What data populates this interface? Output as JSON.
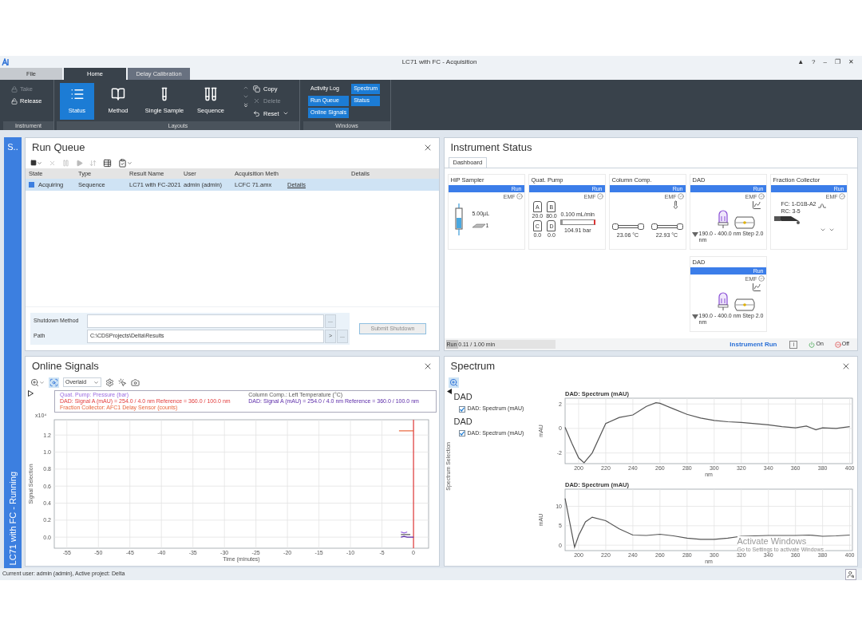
{
  "window": {
    "title": "LC71 with FC - Acquisition",
    "controls": [
      "▲",
      "?",
      "–",
      "❐",
      "✕"
    ]
  },
  "file_menu": "File",
  "ribbon_tabs": [
    {
      "label": "Home",
      "selected": true
    },
    {
      "label": "Delay Calibration",
      "selected": false
    }
  ],
  "ribbon": {
    "instrument": {
      "label": "Instrument",
      "items": [
        {
          "kind": "take",
          "label": "Take",
          "disabled": true
        },
        {
          "kind": "release",
          "label": "Release",
          "disabled": false
        }
      ]
    },
    "layouts": {
      "label": "Layouts",
      "views": [
        {
          "kind": "status",
          "label": "Status",
          "selected": true
        },
        {
          "kind": "method",
          "label": "Method",
          "selected": false
        },
        {
          "kind": "single_sample",
          "label": "Single Sample",
          "selected": false
        },
        {
          "kind": "sequence",
          "label": "Sequence",
          "selected": false
        }
      ],
      "edit_items": [
        {
          "kind": "copy",
          "label": "Copy",
          "disabled": false
        },
        {
          "kind": "delete",
          "label": "Delete",
          "disabled": true
        },
        {
          "kind": "reset",
          "label": "Reset",
          "disabled": false
        }
      ]
    },
    "windows": {
      "label": "Windows",
      "items": [
        {
          "label": "Activity Log",
          "selected": false
        },
        {
          "label": "Spectrum",
          "selected": true
        },
        {
          "label": "Run Queue",
          "selected": true
        },
        {
          "label": "Status",
          "selected": true
        },
        {
          "label": "Online Signals",
          "selected": true
        }
      ]
    }
  },
  "sidebar": {
    "title": "S..",
    "state": "LC71 with FC - Running"
  },
  "run_queue": {
    "title": "Run Queue",
    "columns": [
      "State",
      "Type",
      "Result Name",
      "User",
      "Acquisition Meth",
      "",
      "Details"
    ],
    "rows": [
      {
        "selected": true,
        "cells": [
          {
            "kind": "state",
            "text": "Acquiring"
          },
          {
            "kind": "text",
            "text": "Sequence"
          },
          {
            "kind": "text",
            "text": "LC71 with FC-2021"
          },
          {
            "kind": "text",
            "text": "admin (admin)"
          },
          {
            "kind": "text",
            "text": "LCFC 71.amx"
          },
          {
            "kind": "link",
            "text": "Details"
          }
        ]
      }
    ],
    "shutdown": {
      "method_label": "Shutdown Method",
      "method_browse": "...",
      "path_label": "Path",
      "path_value": "C:\\CDSProjects\\Delta\\Results",
      "path_next": ">",
      "path_browse": "...",
      "submit": "Submit Shutdown",
      "submit_disabled": true
    }
  },
  "instrument_status": {
    "title": "Instrument Status",
    "tabs": [
      {
        "label": "Dashboard",
        "selected": true
      }
    ],
    "modules": [
      {
        "kind": "sampler",
        "name": "HiP Sampler",
        "status": "Run",
        "emf": "EMF",
        "volume": "5.00µL",
        "vial": "1"
      },
      {
        "kind": "pump",
        "name": "Quat. Pump",
        "status": "Run",
        "emf": "EMF",
        "solvents": [
          {
            "letter": "A",
            "value": "20.0"
          },
          {
            "letter": "B",
            "value": "80.0"
          },
          {
            "letter": "C",
            "value": "0.0"
          },
          {
            "letter": "D",
            "value": "0.0"
          }
        ],
        "flow": "0.100 mL/min",
        "pressure": "104.91 bar",
        "level": 0.06
      },
      {
        "kind": "column",
        "name": "Column Comp.",
        "status": "Run",
        "emf": "EMF",
        "temperatures": [
          "23.06 °C",
          "22.93 °C"
        ]
      },
      {
        "kind": "dad",
        "name": "DAD",
        "status": "Run",
        "emf": "EMF",
        "range": "190.0 - 400.0 nm Step 2.0 nm"
      },
      {
        "kind": "fraction",
        "name": "Fraction Collector",
        "status": "Run",
        "emf": "EMF",
        "positions": [
          "FC: 1-D1B-A2",
          "RC: 3-5"
        ]
      },
      {
        "kind": "dad",
        "name": "DAD",
        "status": "Run",
        "emf": "EMF",
        "range": "190.0 - 400.0 nm Step 2.0 nm"
      }
    ],
    "footer": {
      "progress_text": "Run 0.11 / 1.00 min",
      "level": 0.11,
      "instrument_run": "Instrument Run",
      "info": "i",
      "on": "On",
      "off": "Off"
    }
  },
  "online_signals": {
    "title": "Online Signals",
    "view_mode": "Overlaid",
    "y_scale": "x10⁴",
    "chart_data": {
      "type": "line",
      "grid": true,
      "xlabel": "Time (minutes)",
      "ylabel": "Signal Selection",
      "x": [
        -2.3,
        -2,
        -1.5,
        -1,
        -0.5,
        0,
        0
      ],
      "series": [
        {
          "name": "Quat. Pump: Pressure (bar)",
          "color": "#9a6ae0",
          "values": [
            null,
            0.06,
            0.05,
            0.06,
            null,
            null,
            null
          ]
        },
        {
          "name": "DAD: Signal A (mAU) = 254.0 / 4.0 nm Reference = 360.0 / 100.0 nm",
          "color": "#e23a3a",
          "values": [
            null,
            null,
            null,
            null,
            null,
            -0.13,
            1.38
          ]
        },
        {
          "name": "Fraction Collector: AFC1 Delay Sensor (counts)",
          "color": "#e8643a",
          "values": [
            1.25,
            1.25,
            1.25,
            1.25,
            1.25,
            1.25,
            null
          ]
        },
        {
          "name": "Column Comp.: Left Temperature (°C)",
          "color": "#555555",
          "values": [
            null,
            0.03,
            0.03,
            0.03,
            0.03,
            null,
            null
          ]
        },
        {
          "name": "DAD: Signal A (mAU) = 254.0 / 4.0 nm Reference = 360.0 / 100.0 nm",
          "color": "#5b2aa8",
          "values": [
            null,
            0.0,
            0.01,
            0.0,
            0.0,
            0.0,
            null
          ]
        }
      ],
      "xlim": [
        -57,
        2.4
      ],
      "ylim": [
        -0.13,
        1.38
      ],
      "xticks": [
        -55,
        -50,
        -45,
        -40,
        -35,
        -30,
        -25,
        -20,
        -15,
        -10,
        -5,
        0
      ],
      "yticks": [
        {
          "value": 0,
          "label": "0.0"
        },
        {
          "value": 0.2,
          "label": "0.2"
        },
        {
          "value": 0.4,
          "label": "0.4"
        },
        {
          "value": 0.6,
          "label": "0.6"
        },
        {
          "value": 0.8,
          "label": "0.8"
        },
        {
          "value": 1.0,
          "label": "1.0"
        },
        {
          "value": 1.2,
          "label": "1.2"
        }
      ]
    }
  },
  "spectrum": {
    "title": "Spectrum",
    "selection_label": "Spectrum Selection",
    "groups": [
      {
        "name": "DAD",
        "items": [
          {
            "label": "DAD: Spectrum (mAU)",
            "checked": true
          }
        ]
      },
      {
        "name": "DAD",
        "items": [
          {
            "label": "DAD: Spectrum (mAU)",
            "checked": true
          }
        ]
      }
    ],
    "charts": [
      {
        "chart_data": {
          "type": "line",
          "grid": true,
          "xlabel": "nm",
          "ylabel": "mAU",
          "x": [
            190,
            195,
            200,
            204,
            210,
            220,
            230,
            240,
            250,
            257,
            260,
            270,
            280,
            290,
            300,
            310,
            320,
            330,
            340,
            350,
            360,
            368,
            375,
            380,
            390,
            400
          ],
          "series": [
            {
              "name": "DAD: Spectrum (mAU)",
              "color": "#555555",
              "values": [
                0.1,
                -1.2,
                -2.4,
                -2.8,
                -2.0,
                0.4,
                0.9,
                1.1,
                1.8,
                2.1,
                2.05,
                1.6,
                1.15,
                0.85,
                0.65,
                0.55,
                0.5,
                0.4,
                0.3,
                0.15,
                0.05,
                0.2,
                -0.1,
                0.05,
                0.0,
                0.15
              ]
            }
          ],
          "xlim": [
            190,
            402
          ],
          "ylim": [
            -2.87,
            2.47
          ],
          "xticks": [
            200,
            220,
            240,
            260,
            280,
            300,
            320,
            340,
            360,
            380,
            400
          ],
          "yticks": [
            -2,
            0,
            2
          ]
        }
      },
      {
        "chart_data": {
          "type": "line",
          "grid": true,
          "xlabel": "nm",
          "ylabel": "mAU",
          "x": [
            190,
            197,
            200,
            205,
            210,
            220,
            230,
            240,
            250,
            260,
            270,
            280,
            290,
            300,
            310,
            320,
            330,
            340,
            350,
            360,
            370,
            380,
            390,
            400
          ],
          "series": [
            {
              "name": "DAD: Spectrum (mAU)",
              "color": "#555555",
              "values": [
                12,
                -0.5,
                2.5,
                6.0,
                7.2,
                6.3,
                4.2,
                2.6,
                2.5,
                2.8,
                2.4,
                1.8,
                1.5,
                1.5,
                1.8,
                2.3,
                2.4,
                2.5,
                2.5,
                2.5,
                2.6,
                2.3,
                2.4,
                2.6
              ]
            }
          ],
          "xlim": [
            190,
            402
          ],
          "ylim": [
            -1.4,
            14.4
          ],
          "xticks": [
            200,
            220,
            240,
            260,
            280,
            300,
            320,
            340,
            360,
            380,
            400
          ],
          "yticks": [
            0,
            5,
            10
          ]
        }
      }
    ],
    "os_notice": {
      "title": "Activate Windows",
      "text": "Go to Settings to activate Windows."
    }
  },
  "status_bar": {
    "text": "Current user: admin (admin), Active project: Delta"
  }
}
